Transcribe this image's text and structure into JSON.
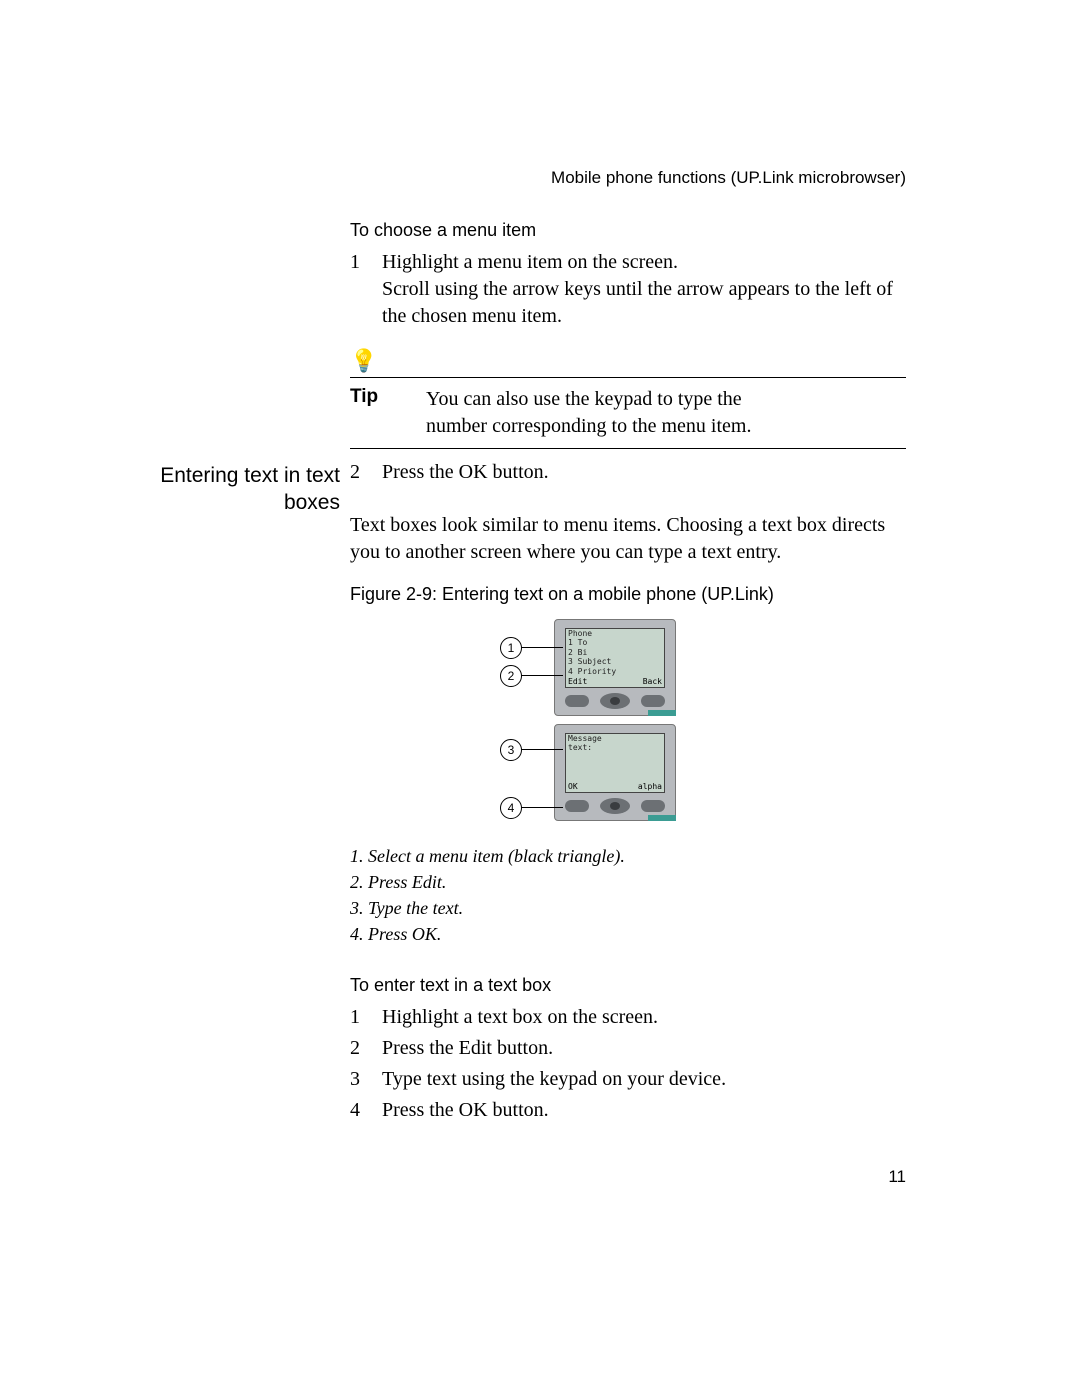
{
  "running_head": "Mobile phone functions (UP.Link microbrowser)",
  "page_number": "11",
  "section1": {
    "heading": "To choose a menu item",
    "step1_num": "1",
    "step1_text": "Highlight a menu item on the screen.",
    "step1_detail": "Scroll using the arrow keys until the arrow appears to the left of the chosen menu item.",
    "tip_label": "Tip",
    "tip_text": "You can also use the keypad to type the number corresponding to the menu item.",
    "step2_num": "2",
    "step2_text": "Press the OK button."
  },
  "margin_heading": "Entering text in text boxes",
  "intro_para": "Text boxes look similar to menu items. Choosing a text box directs you to another screen where you can type a text entry.",
  "figure_caption": "Figure 2-9: Entering text on a mobile phone (UP.Link)",
  "figure": {
    "callouts": {
      "c1": "1",
      "c2": "2",
      "c3": "3",
      "c4": "4"
    },
    "phone1": {
      "line1": "Phone",
      "line2": "1 To",
      "line3": "2 Bi",
      "line4": "3 Subject",
      "line5": "4 Priority",
      "soft_left": "Edit",
      "soft_right": "Back"
    },
    "phone2": {
      "line1": "Message",
      "line2": "text:",
      "soft_left": "OK",
      "soft_right": "alpha"
    }
  },
  "italic_steps": {
    "s1": "1. Select a menu item (black triangle).",
    "s2": "2. Press Edit.",
    "s3": "3. Type the text.",
    "s4": "4. Press OK."
  },
  "section2": {
    "heading": "To enter text in a text box",
    "step1_num": "1",
    "step1_text": "Highlight a text box on the screen.",
    "step2_num": "2",
    "step2_text": "Press the Edit button.",
    "step3_num": "3",
    "step3_text": "Type text using the keypad on your device.",
    "step4_num": "4",
    "step4_text": "Press the OK button."
  }
}
